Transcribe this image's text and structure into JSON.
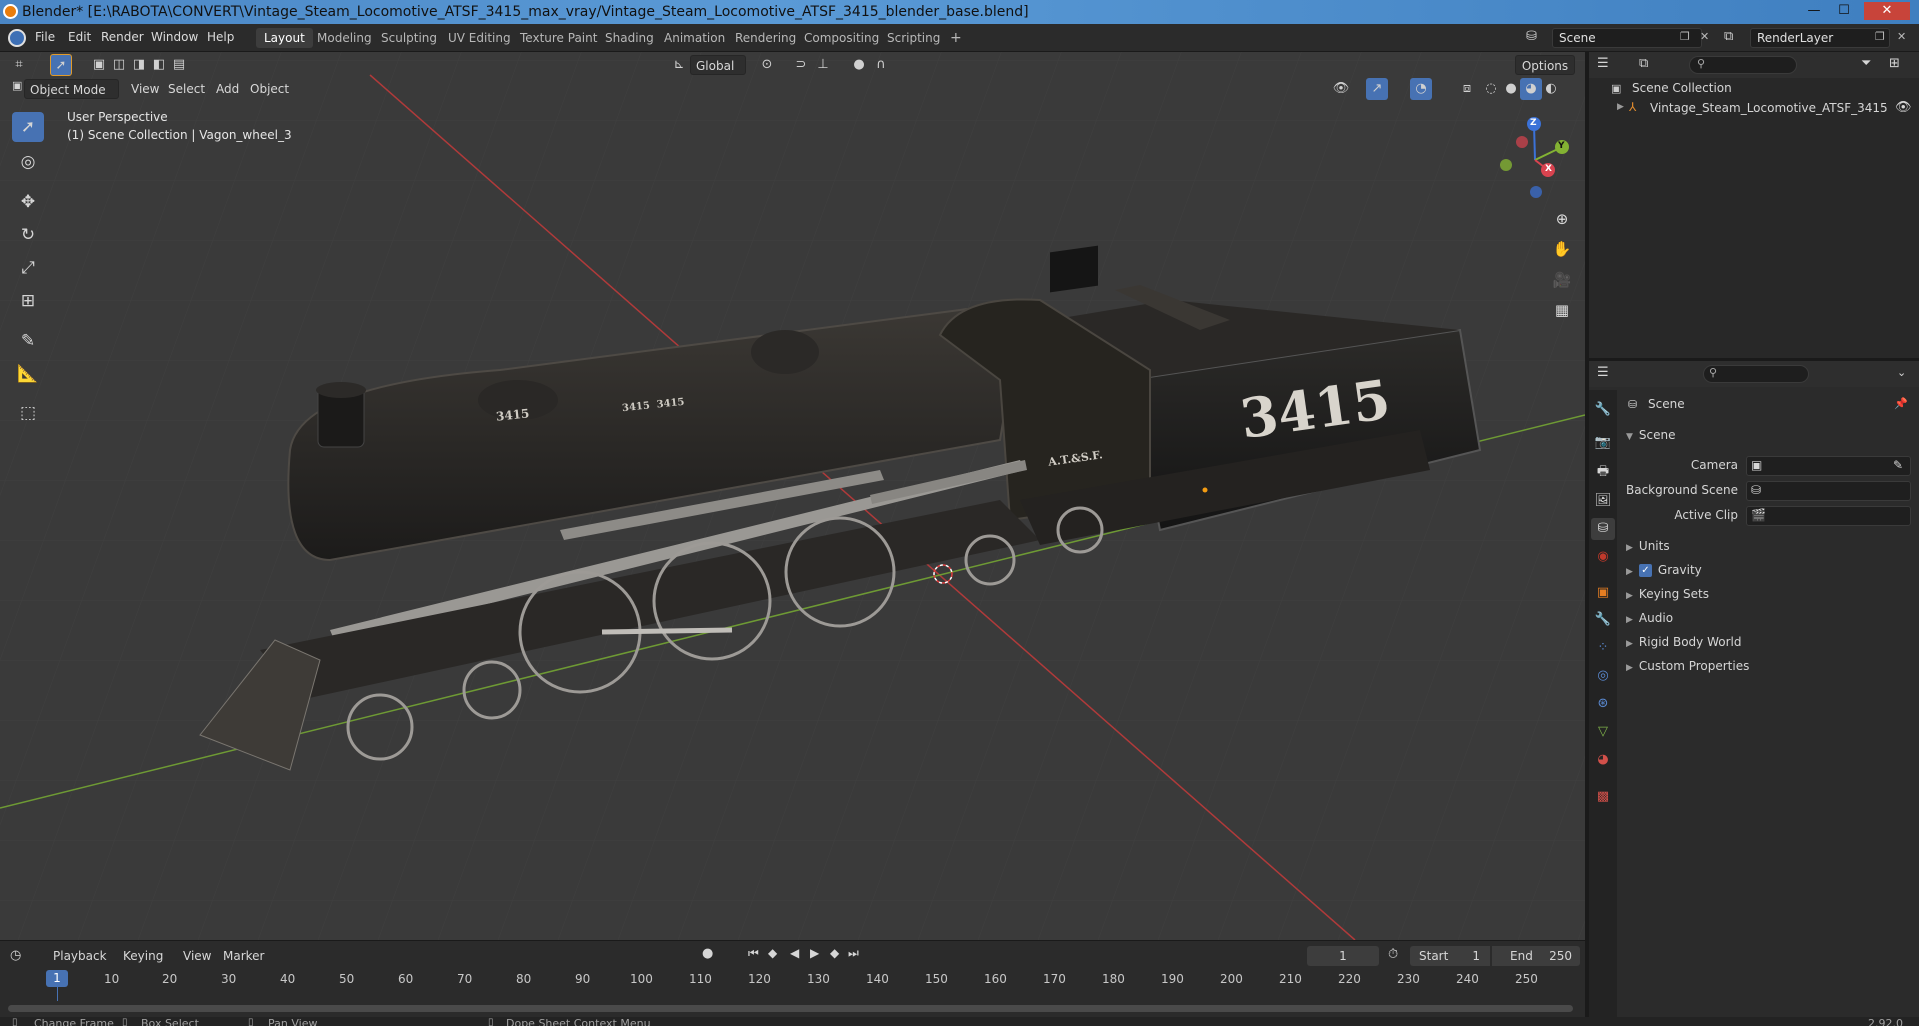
{
  "window": {
    "title": "Blender* [E:\\RABOTA\\CONVERT\\Vintage_Steam_Locomotive_ATSF_3415_max_vray/Vintage_Steam_Locomotive_ATSF_3415_blender_base.blend]",
    "controls": [
      "—",
      "☐",
      "✕"
    ]
  },
  "menu": [
    "File",
    "Edit",
    "Render",
    "Window",
    "Help"
  ],
  "workspaces": [
    "Layout",
    "Modeling",
    "Sculpting",
    "UV Editing",
    "Texture Paint",
    "Shading",
    "Animation",
    "Rendering",
    "Compositing",
    "Scripting",
    "+"
  ],
  "active_workspace": "Layout",
  "scene_field": "Scene",
  "renderlayer_field": "RenderLayer",
  "viewport": {
    "transform_orientation": "Global",
    "options_label": "Options",
    "mode": "Object Mode",
    "header_menu": [
      "View",
      "Select",
      "Add",
      "Object"
    ],
    "overlay_line1": "User Perspective",
    "overlay_line2": "(1) Scene Collection | Vagon_wheel_3",
    "gizmo": {
      "z": "Z",
      "y": "Y",
      "x": "X"
    },
    "model_text_big": "3415",
    "model_text_small": "A.T.&S.F.",
    "model_text_dome": "3415",
    "model_text_boiler": "3415  3415"
  },
  "outliner": {
    "root": "Scene Collection",
    "items": [
      {
        "label": "Vintage_Steam_Locomotive_ATSF_3415",
        "visible": true
      }
    ]
  },
  "properties": {
    "header": "Scene",
    "section": "Scene",
    "fields": [
      {
        "label": "Camera"
      },
      {
        "label": "Background Scene"
      },
      {
        "label": "Active Clip"
      }
    ],
    "panels": [
      "Units",
      "Gravity",
      "Keying Sets",
      "Audio",
      "Rigid Body World",
      "Custom Properties"
    ],
    "gravity_checked": true
  },
  "timeline": {
    "menu": [
      "Playback",
      "Keying",
      "View",
      "Marker"
    ],
    "current_frame": "1",
    "start_label": "Start",
    "start_value": "1",
    "end_label": "End",
    "end_value": "250",
    "ruler": [
      "1",
      "10",
      "20",
      "30",
      "40",
      "50",
      "60",
      "70",
      "80",
      "90",
      "100",
      "110",
      "120",
      "130",
      "140",
      "150",
      "160",
      "170",
      "180",
      "190",
      "200",
      "210",
      "220",
      "230",
      "240",
      "250"
    ]
  },
  "statusbar": {
    "items": [
      "Change Frame",
      "Box Select",
      "Pan View",
      "Dope Sheet Context Menu"
    ],
    "version": "2.92.0"
  },
  "colors": {
    "accent": "#4772b3",
    "viewport_bg": "#3a3a3a",
    "axis_x": "#c33d3d",
    "axis_y": "#7fae3a"
  }
}
